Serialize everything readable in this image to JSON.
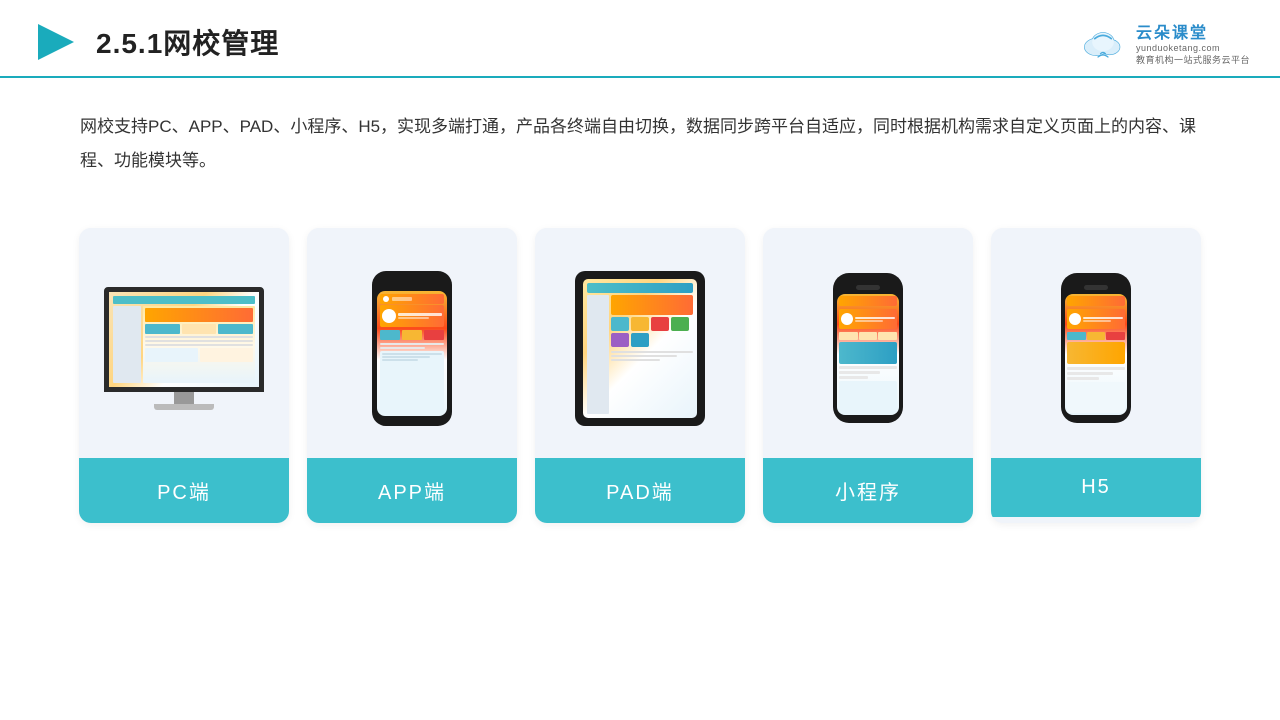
{
  "header": {
    "title": "2.5.1网校管理",
    "logo_name": "云朵课堂",
    "logo_sub": "yunduoketang.com",
    "logo_tagline": "教育机构一站式服务云平台"
  },
  "description": {
    "text": "网校支持PC、APP、PAD、小程序、H5，实现多端打通，产品各终端自由切换，数据同步跨平台自适应，同时根据机构需求自定义页面上的内容、课程、功能模块等。"
  },
  "cards": [
    {
      "id": "pc",
      "label": "PC端"
    },
    {
      "id": "app",
      "label": "APP端"
    },
    {
      "id": "pad",
      "label": "PAD端"
    },
    {
      "id": "mini",
      "label": "小程序"
    },
    {
      "id": "h5",
      "label": "H5"
    }
  ],
  "colors": {
    "accent": "#3cbfcc",
    "title_border": "#1aabbc",
    "logo_blue": "#2a8cca",
    "card_bg": "#f0f4fa",
    "card_label_bg": "#3cbfcc"
  }
}
